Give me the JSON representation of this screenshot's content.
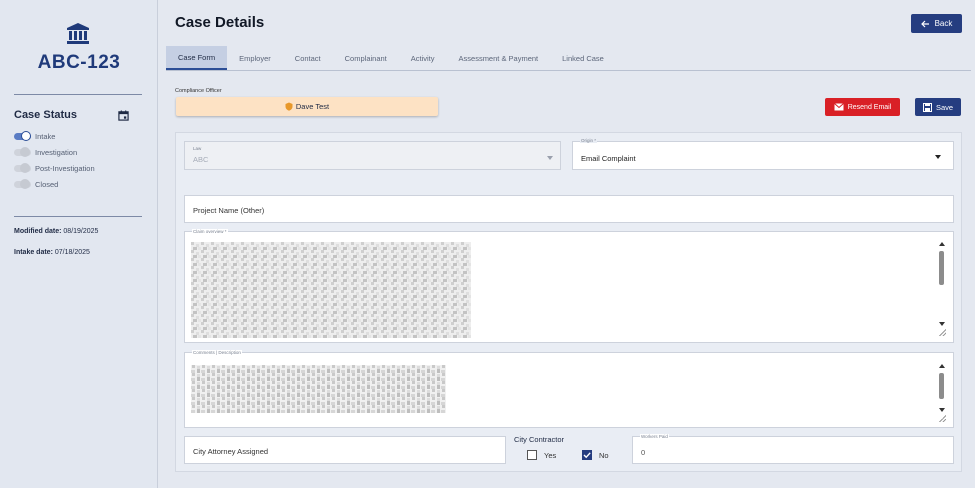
{
  "sidebar": {
    "case_id": "ABC-123",
    "status_title": "Case Status",
    "statuses": [
      {
        "label": "Intake",
        "active": true
      },
      {
        "label": "Investigation",
        "active": false
      },
      {
        "label": "Post-Investigation",
        "active": false
      },
      {
        "label": "Closed",
        "active": false
      }
    ],
    "modified_label": "Modified date:",
    "modified_value": "08/19/2025",
    "intake_label": "Intake date:",
    "intake_value": "07/18/2025"
  },
  "header": {
    "title": "Case Details",
    "back_label": "Back"
  },
  "tabs": [
    "Case Form",
    "Employer",
    "Contact",
    "Complainant",
    "Activity",
    "Assessment & Payment",
    "Linked Case"
  ],
  "active_tab": "Case Form",
  "compliance": {
    "label": "Compliance Officer",
    "officer": "Dave Test"
  },
  "actions": {
    "resend_label": "Resend Email",
    "save_label": "Save"
  },
  "form": {
    "law": {
      "label": "Law",
      "value": "ABC"
    },
    "origin": {
      "label": "Origin *",
      "value": "Email Complaint"
    },
    "project_name": {
      "value": "Project Name (Other)"
    },
    "claim_overview": {
      "label": "Claim overview *"
    },
    "comments": {
      "label": "Comments | Description"
    },
    "city_attorney": {
      "value": "City Attorney Assigned"
    },
    "city_contractor": {
      "label": "City Contractor",
      "yes_label": "Yes",
      "no_label": "No",
      "selected": "No"
    },
    "workers_paid": {
      "label": "Workers Paid",
      "value": "0"
    }
  },
  "colors": {
    "primary": "#253d80",
    "danger": "#d92026",
    "officer_chip": "#fde2c4",
    "sidebar_bg": "#e2e7f0"
  }
}
